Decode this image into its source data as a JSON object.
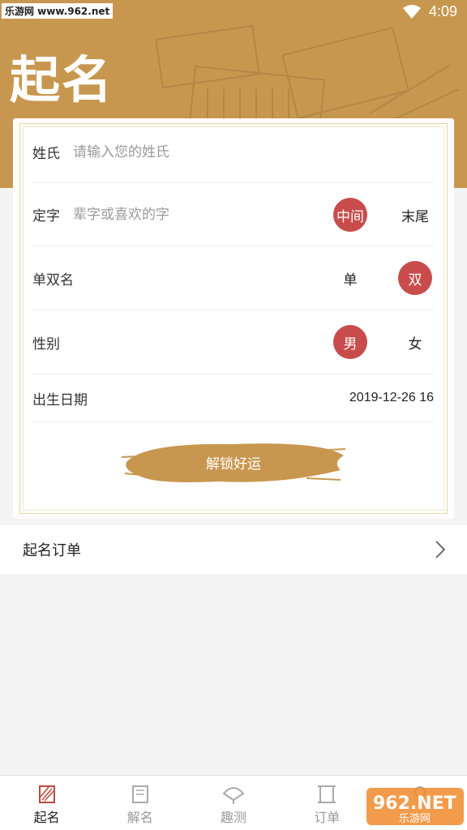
{
  "status_bar": {
    "watermark": "乐游网 www.962.net",
    "time": "4:09"
  },
  "header": {
    "title": "起名"
  },
  "form": {
    "surname": {
      "label": "姓氏",
      "placeholder": "请输入您的姓氏",
      "value": ""
    },
    "fixed_char": {
      "label": "定字",
      "placeholder": "辈字或喜欢的字",
      "value": "",
      "options": [
        "中间",
        "末尾"
      ],
      "selected": "中间"
    },
    "name_length": {
      "label": "单双名",
      "options": [
        "单",
        "双"
      ],
      "selected": "双"
    },
    "gender": {
      "label": "性别",
      "options": [
        "男",
        "女"
      ],
      "selected": "男"
    },
    "birth_date": {
      "label": "出生日期",
      "value": "2019-12-26 16"
    },
    "unlock_button": "解锁好运"
  },
  "orders": {
    "label": "起名订单"
  },
  "tabbar": {
    "items": [
      {
        "label": "起名",
        "active": true
      },
      {
        "label": "解名",
        "active": false
      },
      {
        "label": "趣测",
        "active": false
      },
      {
        "label": "订单",
        "active": false
      }
    ]
  },
  "colors": {
    "header": "#c8974f",
    "accent_red": "#c94c4c",
    "brush": "#c8974f"
  }
}
